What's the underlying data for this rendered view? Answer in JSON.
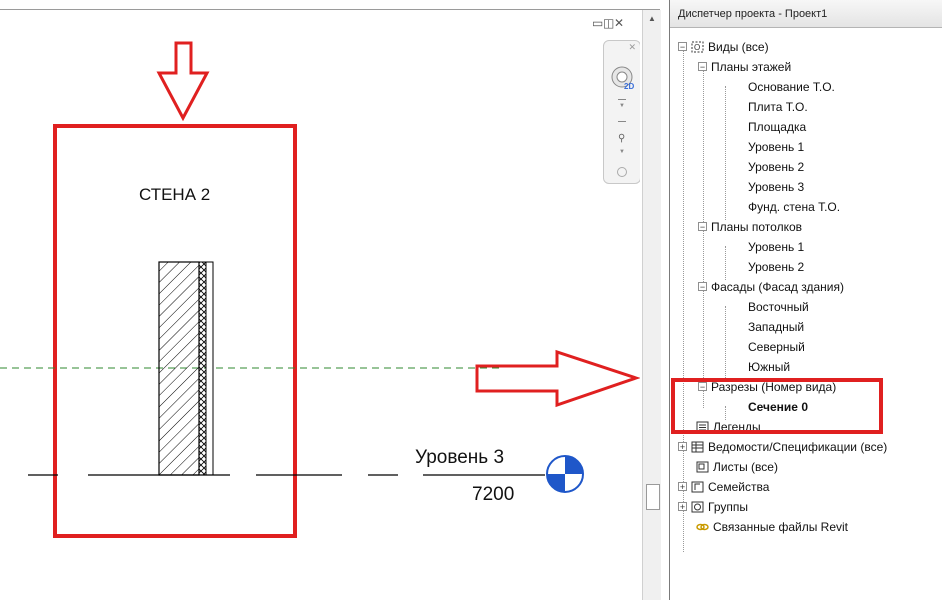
{
  "browser": {
    "title": "Диспетчер проекта - Проект1",
    "tree": [
      {
        "id": "views",
        "label": "Виды (все)",
        "icon": "views-icon",
        "expander": "−"
      },
      {
        "id": "floor-plans",
        "label": "Планы этажей",
        "expander": "−"
      },
      {
        "id": "fp-base",
        "label": "Основание Т.О."
      },
      {
        "id": "fp-slab",
        "label": "Плита Т.О."
      },
      {
        "id": "fp-site",
        "label": "Площадка"
      },
      {
        "id": "fp-l1",
        "label": "Уровень 1"
      },
      {
        "id": "fp-l2",
        "label": "Уровень 2"
      },
      {
        "id": "fp-l3",
        "label": "Уровень 3"
      },
      {
        "id": "fp-fwall",
        "label": "Фунд. стена Т.О."
      },
      {
        "id": "ceiling-plans",
        "label": "Планы потолков",
        "expander": "−"
      },
      {
        "id": "cp-l1",
        "label": "Уровень 1"
      },
      {
        "id": "cp-l2",
        "label": "Уровень 2"
      },
      {
        "id": "elevations",
        "label": "Фасады (Фасад здания)",
        "expander": "−"
      },
      {
        "id": "el-east",
        "label": "Восточный"
      },
      {
        "id": "el-west",
        "label": "Западный"
      },
      {
        "id": "el-north",
        "label": "Северный"
      },
      {
        "id": "el-south",
        "label": "Южный"
      },
      {
        "id": "sections",
        "label": "Разрезы (Номер вида)",
        "expander": "−"
      },
      {
        "id": "section-0",
        "label": "Сечение 0"
      },
      {
        "id": "legends",
        "label": "Легенды",
        "icon": "legends-icon"
      },
      {
        "id": "schedules",
        "label": "Ведомости/Спецификации (все)",
        "icon": "schedule-icon",
        "expander": "+"
      },
      {
        "id": "sheets",
        "label": "Листы (все)",
        "icon": "sheets-icon"
      },
      {
        "id": "families",
        "label": "Семейства",
        "icon": "families-icon",
        "expander": "+"
      },
      {
        "id": "groups",
        "label": "Группы",
        "icon": "groups-icon",
        "expander": "+"
      },
      {
        "id": "links",
        "label": "Связанные файлы Revit",
        "icon": "revit-links-icon"
      }
    ]
  },
  "canvas": {
    "wall_label": "СТЕНА 2",
    "level_name": "Уровень 3",
    "level_elevation": "7200"
  },
  "colors": {
    "annotation_red": "#e02020",
    "level_marker_blue": "#1f57c9",
    "section_line_green": "#2f8a2f"
  }
}
